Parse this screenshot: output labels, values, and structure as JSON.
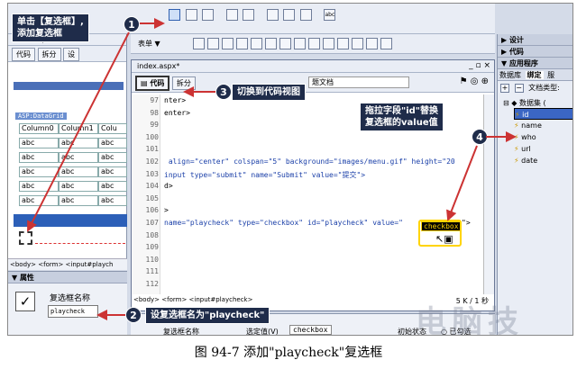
{
  "callouts": {
    "c1": "单击【复选框】,\n添加复选框",
    "c2": "设复选框名为\"playcheck\"",
    "c3": "切换到代码视图",
    "c4": "拖拉字段\"id\"替换\n复选框的value值"
  },
  "steps": [
    "1",
    "2",
    "3",
    "4"
  ],
  "toolbar": {
    "form_menu": "表单 ▼",
    "abc": "abc"
  },
  "left_doc": {
    "tab": "index.aspx*",
    "code_btn": "代码",
    "split_btn": "拆分",
    "design_btn": "设",
    "datagrid_label": "ASP:DataGrid",
    "columns": [
      "Column0",
      "Column1",
      "Colu"
    ],
    "cell": "abc",
    "tag_path": "<body> <form> <input#playch",
    "props_title": "▼ 属性",
    "checkbox_name_label": "复选框名称",
    "checkbox_name_value": "playcheck"
  },
  "editor": {
    "tab": "index.aspx*",
    "code_btn": "代码",
    "split_btn": "拆分",
    "title_text": "题文档",
    "lines": [
      {
        "n": "97",
        "t": "nter>"
      },
      {
        "n": "98",
        "t": "enter>"
      },
      {
        "n": "99",
        "t": ""
      },
      {
        "n": "100",
        "t": ""
      },
      {
        "n": "101",
        "t": ""
      },
      {
        "n": "102",
        "t": " align=\"center\" colspan=\"5\" background=\"images/menu.gif\" height=\"20"
      },
      {
        "n": "103",
        "t": "input type=\"submit\" name=\"Submit\" value=\"提交\">"
      },
      {
        "n": "104",
        "t": "d>"
      },
      {
        "n": "105",
        "t": ""
      },
      {
        "n": "106",
        "t": ">"
      },
      {
        "n": "107",
        "t": "name=\"playcheck\" type=\"checkbox\" id=\"playcheck\" value=\""
      },
      {
        "n": "108",
        "t": ""
      },
      {
        "n": "109",
        "t": ""
      },
      {
        "n": "110",
        "t": ""
      },
      {
        "n": "111",
        "t": ""
      },
      {
        "n": "112",
        "t": ""
      }
    ],
    "drag_value": "checkbox",
    "drag_end": "\">",
    "tag_path": "<body> <form> <input#playcheck>",
    "status": "5 K / 1 秒"
  },
  "props_bottom": {
    "name_label": "复选框名称",
    "selected_label": "选定值(V)",
    "selected_value": "checkbox",
    "initial_label": "初始状态",
    "checked": "已勾选"
  },
  "right": {
    "design": "▶ 设计",
    "code": "▶ 代码",
    "app": "▼ 应用程序",
    "tabs": [
      "数据库",
      "绑定",
      "服"
    ],
    "doc_type": "文档类型:",
    "dataset": "数据集 (",
    "fields": [
      "id",
      "name",
      "who",
      "url",
      "date"
    ]
  },
  "caption": "图 94-7   添加\"playcheck\"复选框",
  "watermark": "电脑技"
}
